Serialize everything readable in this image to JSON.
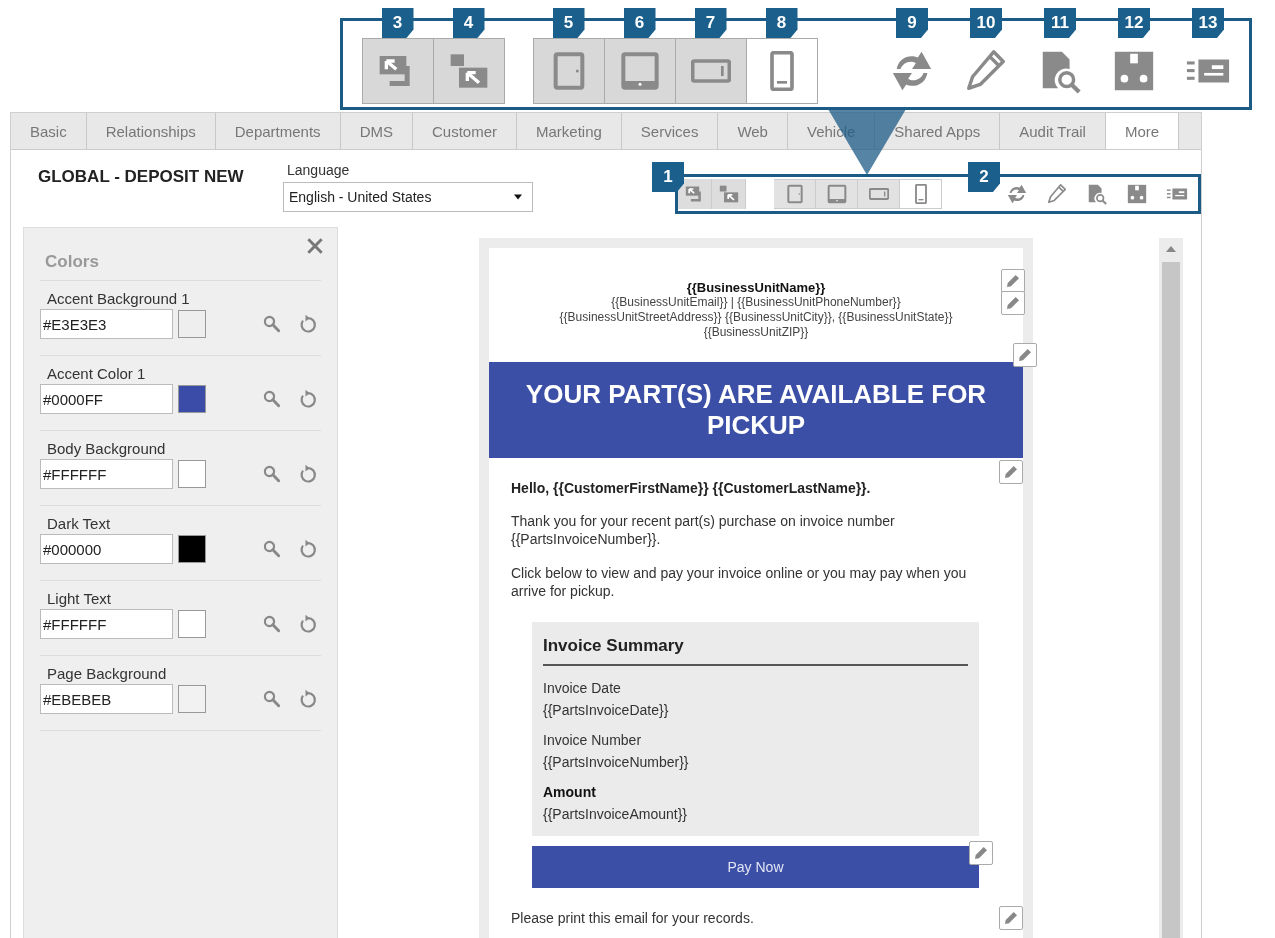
{
  "callout_toolbar": {
    "groups": [
      {
        "kind": "view",
        "buttons": [
          {
            "number": "3"
          },
          {
            "number": "4"
          }
        ]
      },
      {
        "kind": "device",
        "buttons": [
          {
            "number": "5",
            "selected": false
          },
          {
            "number": "6",
            "selected": false
          },
          {
            "number": "7",
            "selected": false
          },
          {
            "number": "8",
            "selected": true
          }
        ]
      },
      {
        "kind": "action",
        "buttons": [
          {
            "number": "9"
          },
          {
            "number": "10"
          },
          {
            "number": "11"
          },
          {
            "number": "12"
          },
          {
            "number": "13"
          }
        ]
      }
    ]
  },
  "tabs": [
    {
      "label": "Basic",
      "selected": false
    },
    {
      "label": "Relationships",
      "selected": false
    },
    {
      "label": "Departments",
      "selected": false
    },
    {
      "label": "DMS",
      "selected": false
    },
    {
      "label": "Customer",
      "selected": false
    },
    {
      "label": "Marketing",
      "selected": false
    },
    {
      "label": "Services",
      "selected": false
    },
    {
      "label": "Web",
      "selected": false
    },
    {
      "label": "Vehicle",
      "selected": false
    },
    {
      "label": "Shared Apps",
      "selected": false
    },
    {
      "label": "Audit Trail",
      "selected": false
    },
    {
      "label": "More",
      "selected": true
    }
  ],
  "template": {
    "title": "GLOBAL - DEPOSIT NEW",
    "language": {
      "label": "Language",
      "value": "English - United States"
    }
  },
  "toolbar": {
    "callouts": [
      "1",
      "2"
    ],
    "devices": [
      {
        "selected": false
      },
      {
        "selected": false
      },
      {
        "selected": false
      },
      {
        "selected": true
      }
    ]
  },
  "colors_panel": {
    "title": "Colors",
    "fields": [
      {
        "label": "Accent Background 1",
        "value": "#E3E3E3",
        "color": "#eeeeee"
      },
      {
        "label": "Accent Color 1",
        "value": "#0000FF",
        "color": "#3a4ca8"
      },
      {
        "label": "Body Background",
        "value": "#FFFFFF",
        "color": "#ffffff"
      },
      {
        "label": "Dark Text",
        "value": "#000000",
        "color": "#000000"
      },
      {
        "label": "Light Text",
        "value": "#FFFFFF",
        "color": "#ffffff"
      },
      {
        "label": "Page Background",
        "value": "#EBEBEB",
        "color": "#f2f2f2"
      }
    ]
  },
  "email": {
    "header": {
      "name": "{{BusinessUnitName}}",
      "lines": [
        "{{BusinessUnitEmail}} | {{BusinessUnitPhoneNumber}}",
        "{{BusinessUnitStreetAddress}} {{BusinessUnitCity}}, {{BusinessUnitState}}",
        "{{BusinessUnitZIP}}"
      ]
    },
    "banner": "YOUR PART(S) ARE AVAILABLE FOR PICKUP",
    "greeting": "Hello, {{CustomerFirstName}} {{CustomerLastName}}.",
    "paragraphs": [
      "Thank you for your recent part(s) purchase on invoice number {{PartsInvoiceNumber}}.",
      "Click below to view and pay your invoice online or you may pay when you arrive for pickup."
    ],
    "invoice_summary": {
      "title": "Invoice Summary",
      "items": [
        {
          "label": "Invoice Date",
          "value": "{{PartsInvoiceDate}}",
          "bold": false
        },
        {
          "label": "Invoice Number",
          "value": "{{PartsInvoiceNumber}}",
          "bold": false
        },
        {
          "label": "Amount",
          "value": "{{PartsInvoiceAmount}}",
          "bold": true
        }
      ]
    },
    "button": "Pay Now",
    "footer": "Please print this email for your records."
  }
}
